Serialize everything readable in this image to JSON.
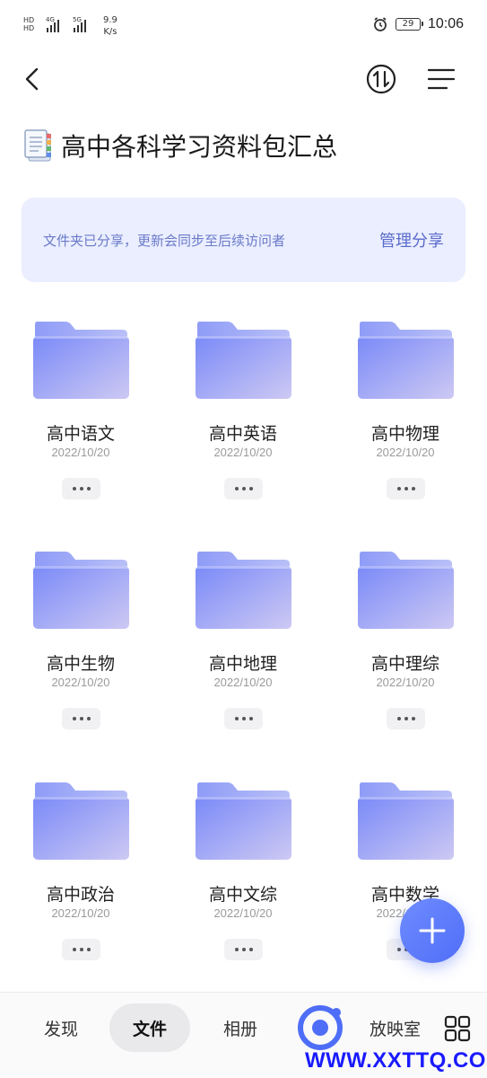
{
  "status_bar": {
    "sim1": "HD",
    "sim2": "HD",
    "net1": "4G",
    "net2": "5G",
    "speed_value": "9.9",
    "speed_unit": "K/s",
    "battery": "29",
    "time": "10:06",
    "icons": [
      "alarm-icon",
      "battery-icon"
    ]
  },
  "header": {
    "back_icon": "back-icon",
    "sort_icon": "sort-icon",
    "menu_icon": "menu-icon",
    "title": "高中各科学习资料包汇总"
  },
  "share_banner": {
    "text": "文件夹已分享，更新会同步至后续访问者",
    "action": "管理分享"
  },
  "folders": [
    {
      "name": "高中语文",
      "date": "2022/10/20"
    },
    {
      "name": "高中英语",
      "date": "2022/10/20"
    },
    {
      "name": "高中物理",
      "date": "2022/10/20"
    },
    {
      "name": "高中生物",
      "date": "2022/10/20"
    },
    {
      "name": "高中地理",
      "date": "2022/10/20"
    },
    {
      "name": "高中理综",
      "date": "2022/10/20"
    },
    {
      "name": "高中政治",
      "date": "2022/10/20"
    },
    {
      "name": "高中文综",
      "date": "2022/10/20"
    },
    {
      "name": "高中数学",
      "date": "2022/10/20"
    }
  ],
  "bottom_nav": {
    "items": [
      "发现",
      "文件",
      "相册",
      "放映室"
    ],
    "active": "文件"
  },
  "watermark": "WWW.XXTTQ.COM",
  "colors": {
    "accent": "#5a6acb",
    "banner_bg": "#eaeeff",
    "folder_top": "#7f8ff8",
    "folder_bottom": "#c9c6f4"
  }
}
